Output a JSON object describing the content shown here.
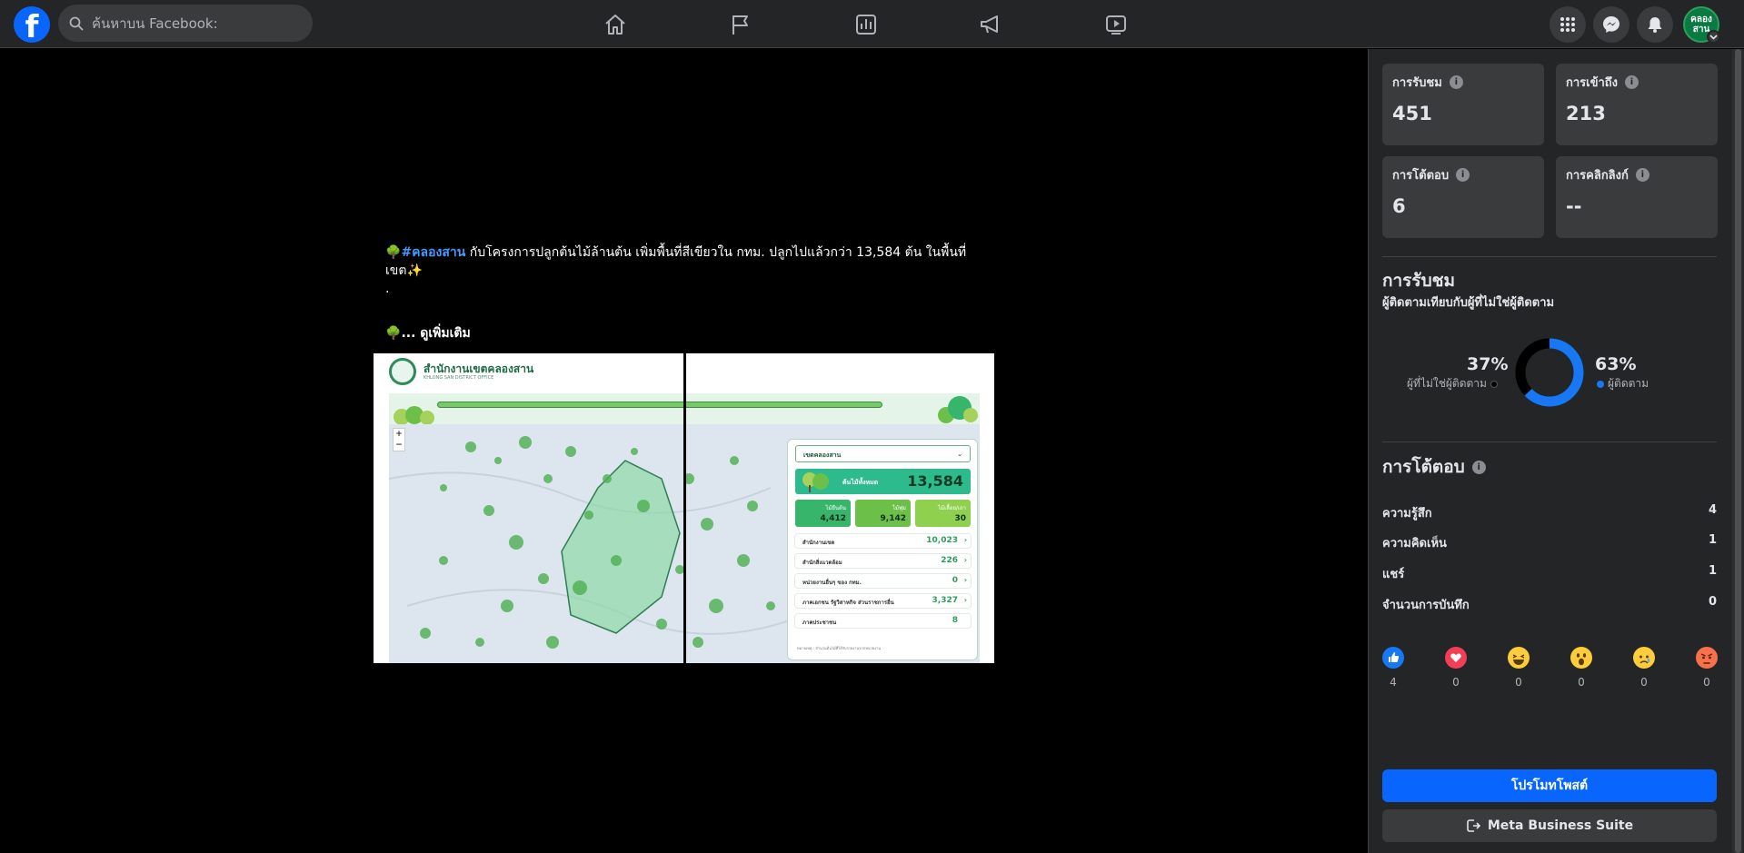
{
  "topbar": {
    "logo_letter": "f",
    "search_placeholder": "ค้นหาบน Facebook:",
    "avatar_line1": "คลอง",
    "avatar_line2": "สาน",
    "nav_icons": [
      "home-icon",
      "flag-icon",
      "bar-chart-icon",
      "megaphone-icon",
      "video-play-icon"
    ],
    "right_icons": [
      "grid-menu-icon",
      "messenger-icon",
      "notification-bell-icon"
    ]
  },
  "post": {
    "caption_hashtag": "#คลองสาน",
    "caption_text": " กับโครงการปลูกต้นไม้ล้านต้น เพิ่มพื้นที่สีเขียวใน กทม. ปลูกไปแล้วกว่า 13,584 ต้น ในพื้นที่เขต✨",
    "caption_dot": ".",
    "see_more": "... ดูเพิ่มเติม",
    "image": {
      "office_name": "สำนักงานเขตคลองสาน",
      "office_sub": "KHLONG SAN DISTRICT OFFICE",
      "dropdown": "เขตคลองสาน",
      "total_label": "ต้นไม้ทั้งหมด",
      "total_value": "13,584",
      "mini_cards": [
        {
          "label": "ไม้ยืนต้น",
          "value": "4,412",
          "color": "#37b56b"
        },
        {
          "label": "ไม้พุ่ม",
          "value": "9,142",
          "color": "#6cc04a"
        },
        {
          "label": "ไม้เลื้อย/เถา",
          "value": "30",
          "color": "#8fd14f"
        }
      ],
      "rows": [
        {
          "label": "สำนักงานเขต",
          "value": "10,023"
        },
        {
          "label": "สำนักสิ่งแวดล้อม",
          "value": "226"
        },
        {
          "label": "หน่วยงานอื่นๆ ของ กทม.",
          "value": "0"
        },
        {
          "label": "ภาคเอกชน รัฐวิสาหกิจ ส่วนราชการอื่น",
          "value": "3,327"
        },
        {
          "label": "ภาคประชาชน",
          "value": "8"
        }
      ],
      "note": "หมายเหตุ : จำนวนต้นไม้ที่ได้รับรายงานจากหน่วยงาน"
    }
  },
  "insights": {
    "stats": [
      {
        "label": "การรับชม",
        "value": "451"
      },
      {
        "label": "การเข้าถึง",
        "value": "213"
      },
      {
        "label": "การโต้ตอบ",
        "value": "6"
      },
      {
        "label": "การคลิกลิงก์",
        "value": "--"
      }
    ],
    "views_title": "การรับชม",
    "views_subtitle": "ผู้ติดตามเทียบกับผู้ที่ไม่ใช่ผู้ติดตาม",
    "non_followers_pct": "37%",
    "non_followers_label": "ผู้ที่ไม่ใช่ผู้ติดตาม",
    "followers_pct": "63%",
    "followers_label": "ผู้ติดตาม",
    "donut_followers_fraction": 0.63,
    "colors": {
      "followers": "#1877f2",
      "non_followers": "#000000",
      "accent": "#0866ff"
    },
    "interactions_title": "การโต้ตอบ",
    "interactions": [
      {
        "label": "ความรู้สึก",
        "value": "4"
      },
      {
        "label": "ความคิดเห็น",
        "value": "1"
      },
      {
        "label": "แชร์",
        "value": "1"
      },
      {
        "label": "จำนวนการบันทึก",
        "value": "0"
      }
    ],
    "reactions": [
      {
        "name": "like-reaction-icon",
        "count": "4"
      },
      {
        "name": "love-reaction-icon",
        "count": "0"
      },
      {
        "name": "haha-reaction-icon",
        "count": "0"
      },
      {
        "name": "wow-reaction-icon",
        "count": "0"
      },
      {
        "name": "sad-reaction-icon",
        "count": "0"
      },
      {
        "name": "angry-reaction-icon",
        "count": "0"
      }
    ],
    "promote_button": "โปรโมทโพสต์",
    "business_suite_button": "Meta Business Suite"
  }
}
